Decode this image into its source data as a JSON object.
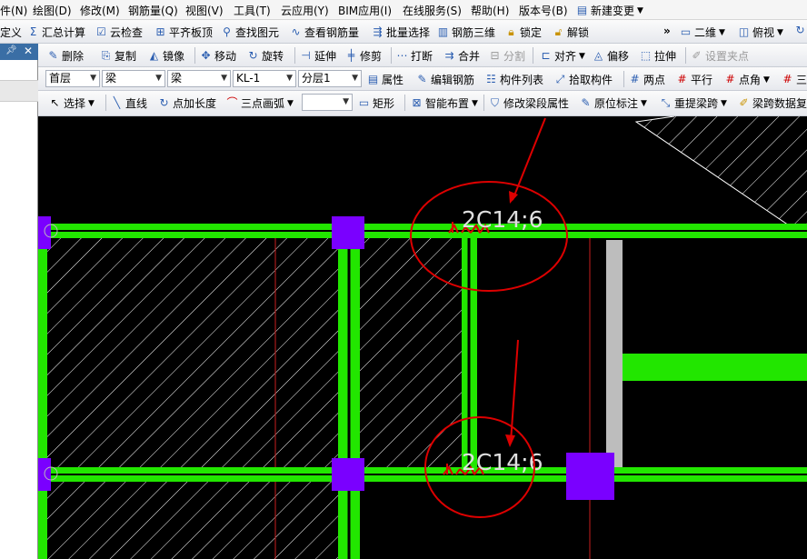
{
  "menu": [
    "件(N)",
    "绘图(D)",
    "修改(M)",
    "钢筋量(Q)",
    "视图(V)",
    "工具(T)",
    "云应用(Y)",
    "BIM应用(I)",
    "在线服务(S)",
    "帮助(H)",
    "版本号(B)",
    "新建变更"
  ],
  "toolbar1": {
    "define": "定义",
    "summary_calc": "汇总计算",
    "cloud_check": "云检查",
    "level_slab": "平齐板顶",
    "find_element": "查找图元",
    "view_rebar": "查看钢筋量",
    "batch_select": "批量选择",
    "rebar_3d": "钢筋三维",
    "lock": "锁定",
    "unlock": "解锁",
    "more": "»",
    "view_mode": "二维",
    "view_dir": "俯视"
  },
  "toolbar2": {
    "delete": "删除",
    "copy": "复制",
    "mirror": "镜像",
    "move": "移动",
    "rotate": "旋转",
    "extend": "延伸",
    "trim": "修剪",
    "break": "打断",
    "merge": "合并",
    "split": "分割",
    "align": "对齐",
    "offset": "偏移",
    "stretch": "拉伸",
    "set_grip": "设置夹点"
  },
  "toolbar3": {
    "floor": "首层",
    "category": "梁",
    "type": "梁",
    "component": "KL-1",
    "sublayer": "分层1",
    "properties": "属性",
    "edit_rebar": "编辑钢筋",
    "component_list": "构件列表",
    "pick_component": "拾取构件",
    "two_points": "两点",
    "parallel": "平行",
    "point_angle": "点角",
    "three_point_axis": "三"
  },
  "toolbar4": {
    "select": "选择",
    "line": "直线",
    "point_length": "点加长度",
    "three_point_arc": "三点画弧",
    "empty_drop": "",
    "rectangle": "矩形",
    "smart_layout": "智能布置",
    "modify_span_props": "修改梁段属性",
    "in_situ_label": "原位标注",
    "re_extract_span": "重提梁跨",
    "span_data": "梁跨数据复"
  },
  "drawing": {
    "label_top": "2C14;6",
    "label_bottom": "2C14;6",
    "colors": {
      "beam": "#22e600",
      "column": "#7a00ff",
      "hatch": "#ffffff",
      "annotation": "#dd0000",
      "rebar_label": "#e0e0e0",
      "wall": "#bdbdbd"
    }
  }
}
